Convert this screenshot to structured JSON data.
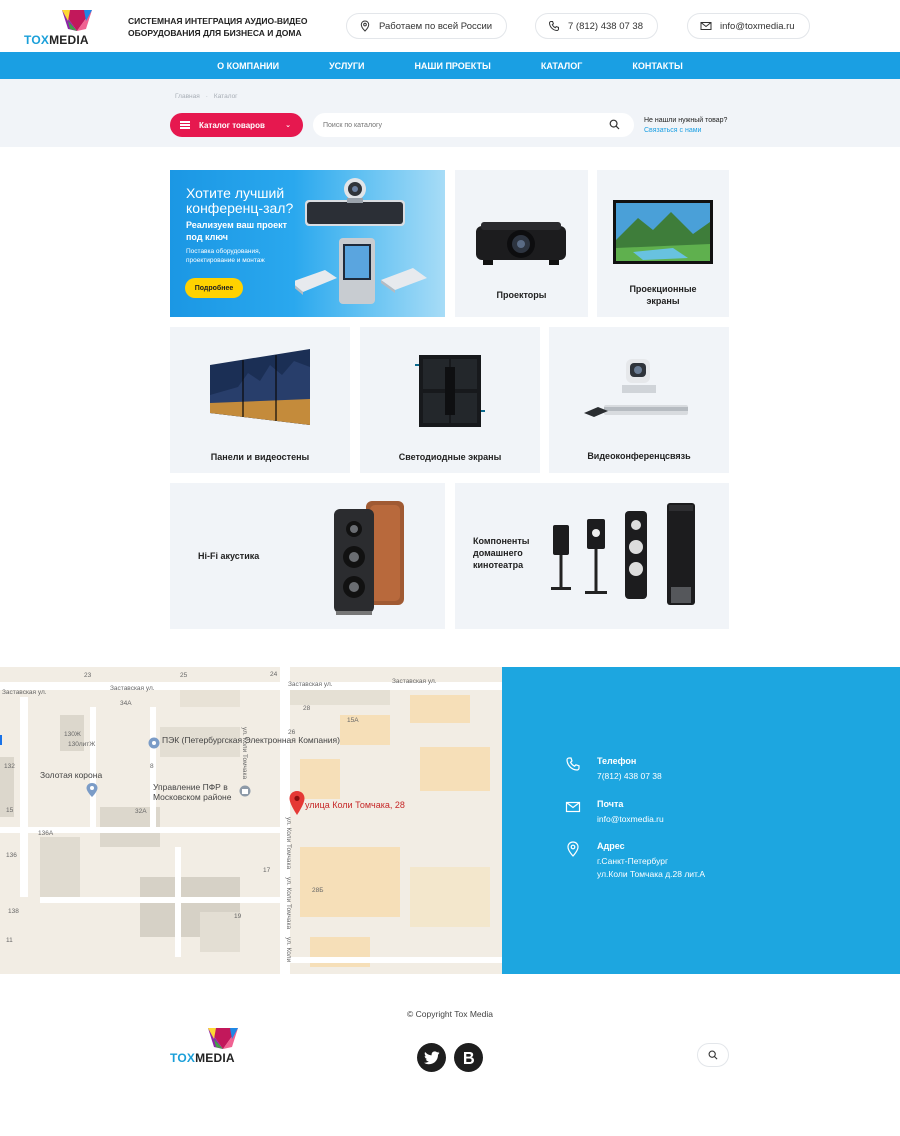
{
  "header": {
    "logo": {
      "tox": "TOX",
      "media": "MEDIA"
    },
    "tagline": "СИСТЕМНАЯ ИНТЕГРАЦИЯ АУДИО-ВИДЕО ОБОРУДОВАНИЯ ДЛЯ БИЗНЕСА И ДОМА",
    "location": "Работаем по всей России",
    "phone": "7 (812) 438 07 38",
    "email": "info@toxmedia.ru"
  },
  "nav": {
    "items": [
      "О КОМПАНИИ",
      "УСЛУГИ",
      "НАШИ ПРОЕКТЫ",
      "КАТАЛОГ",
      "КОНТАКТЫ"
    ]
  },
  "breadcrumbs": [
    "Главная",
    "Каталог"
  ],
  "catalog_button": {
    "label": "Каталог товаров"
  },
  "search": {
    "placeholder": "Поиск по каталогу"
  },
  "help": {
    "question": "Не нашли нужный товар?",
    "link": "Связаться с нами"
  },
  "banner": {
    "title": "Хотите лучший конференц-зал?",
    "subtitle": "Реализуем ваш проект под ключ",
    "description": "Поставка оборудования, проектирование и монтаж",
    "button": "Подробнее"
  },
  "categories": [
    "Проекторы",
    "Проекционные экраны",
    "Панели и видеостены",
    "Светодиодные экраны",
    "Видеоконференцсвязь",
    "Hi-Fi акустика",
    "Компоненты домашнего кинотеатра"
  ],
  "map": {
    "streets": [
      "Заставская ул.",
      "Заставская ул.",
      "Заставская ул.",
      "Заставская ул.",
      "ул. Коли Томчака",
      "ул. Коли Томчака",
      "ул. Коли Томчака",
      "ул. Коли"
    ],
    "houses": [
      "23",
      "25",
      "24",
      "34А",
      "15А",
      "28",
      "26",
      "130Ж",
      "130литЖ",
      "132",
      "32А",
      "136А",
      "136",
      "138",
      "17",
      "19",
      "28Б",
      "15",
      "11",
      "8"
    ],
    "pois": [
      "ПЭК (Петербургская Электронная Компания)",
      "Золотая корона",
      "Управление ПФР в Московском районе"
    ],
    "address_marker": "улица Коли Томчака, 28"
  },
  "contacts": {
    "phone": {
      "title": "Телефон",
      "value": "7(812) 438 07 38"
    },
    "mail": {
      "title": "Почта",
      "value": "info@toxmedia.ru"
    },
    "address": {
      "title": "Адрес",
      "line1": "г.Санкт-Петербург",
      "line2": "ул.Коли Томчака д.28 лит.А"
    }
  },
  "footer": {
    "copyright": "© Copyright Tox Media",
    "logo": {
      "tox": "TOX",
      "media": "MEDIA"
    },
    "social": [
      "twitter-icon",
      "vk-icon"
    ]
  },
  "colors": {
    "accent_blue": "#1a9fe3",
    "contacts_blue": "#1da6e0",
    "catalog_red": "#e6184f",
    "banner_button": "#ffd200",
    "card_bg": "#f1f4f8"
  }
}
